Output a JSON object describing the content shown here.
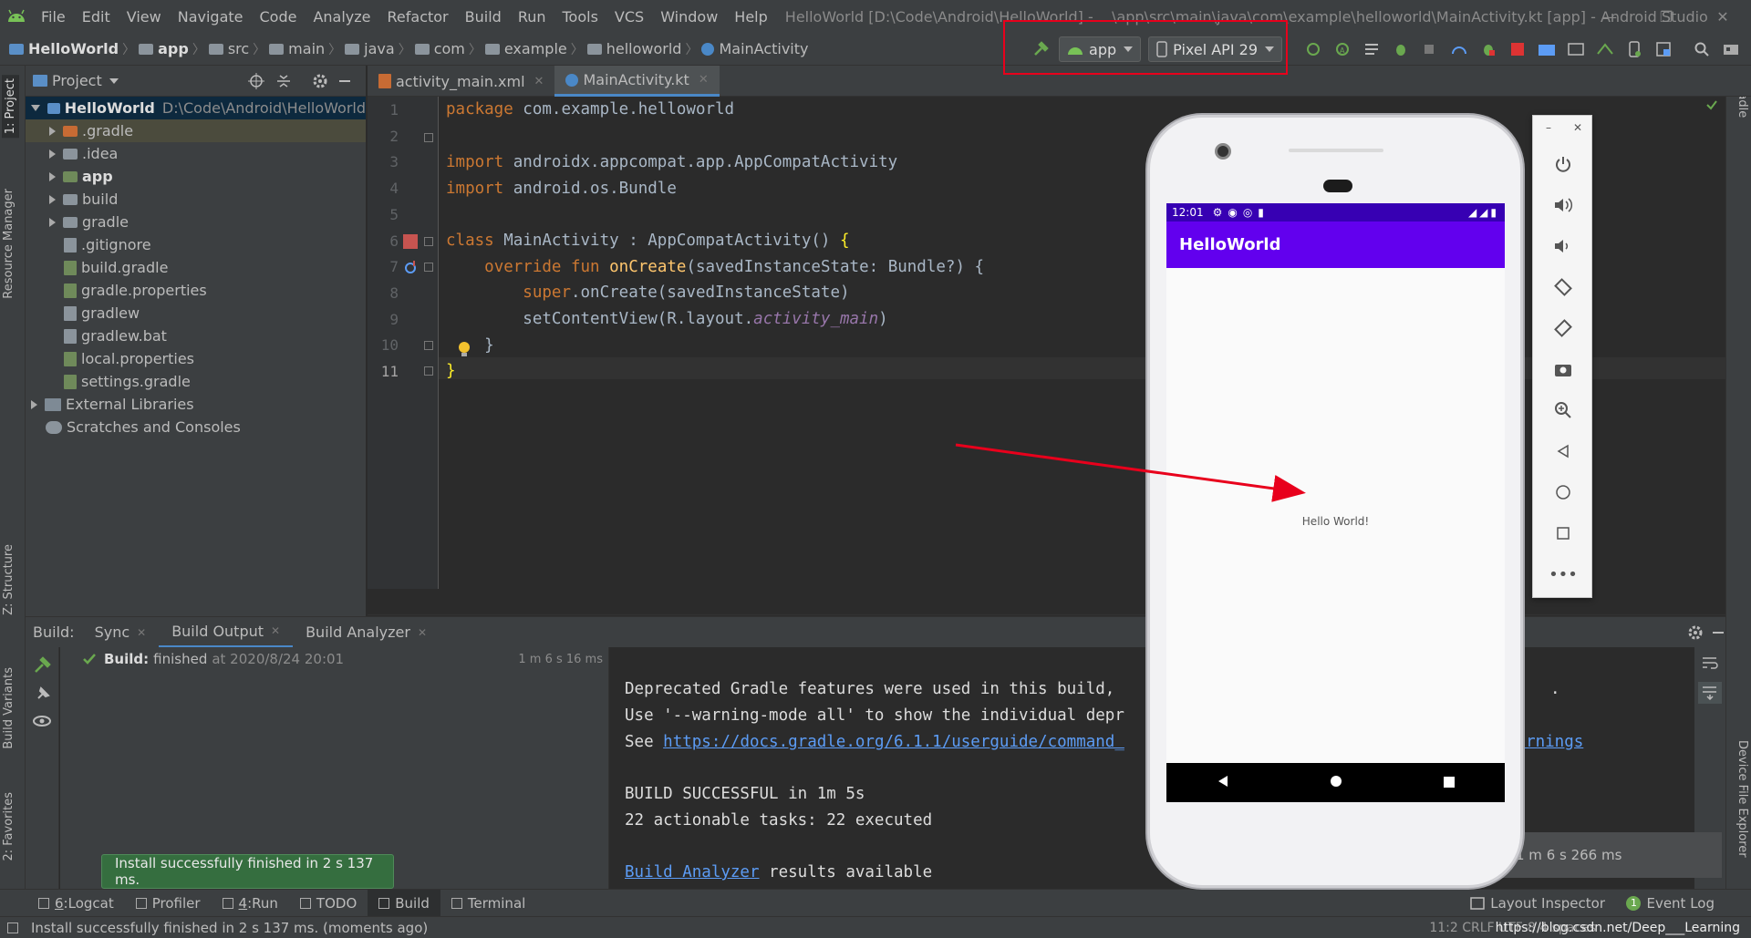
{
  "window": {
    "menus": [
      "File",
      "Edit",
      "View",
      "Navigate",
      "Code",
      "Analyze",
      "Refactor",
      "Build",
      "Run",
      "Tools",
      "VCS",
      "Window",
      "Help"
    ],
    "title": "HelloWorld [D:\\Code\\Android\\HelloWorld] - ...\\app\\src\\main\\java\\com\\example\\helloworld\\MainActivity.kt [app] - Android Studio"
  },
  "breadcrumbs": [
    "HelloWorld",
    "app",
    "src",
    "main",
    "java",
    "com",
    "example",
    "helloworld",
    "MainActivity"
  ],
  "toolbar": {
    "run_config": "app",
    "device": "Pixel API 29"
  },
  "stripes": {
    "left": [
      "1: Project",
      "Resource Manager",
      "Z: Structure",
      "Build Variants",
      "2: Favorites"
    ],
    "right": [
      "Gradle",
      "Device File Explorer"
    ]
  },
  "project": {
    "header": "Project",
    "root": {
      "name": "HelloWorld",
      "path": "D:\\Code\\Android\\HelloWorld"
    },
    "items": [
      {
        "name": ".gradle",
        "kind": "folder-orange",
        "expandable": true
      },
      {
        "name": ".idea",
        "kind": "folder",
        "expandable": true
      },
      {
        "name": "app",
        "kind": "folder-module",
        "expandable": true
      },
      {
        "name": "build",
        "kind": "folder",
        "expandable": true
      },
      {
        "name": "gradle",
        "kind": "folder",
        "expandable": true
      },
      {
        "name": ".gitignore",
        "kind": "file"
      },
      {
        "name": "build.gradle",
        "kind": "gradle"
      },
      {
        "name": "gradle.properties",
        "kind": "gradle"
      },
      {
        "name": "gradlew",
        "kind": "file"
      },
      {
        "name": "gradlew.bat",
        "kind": "file"
      },
      {
        "name": "local.properties",
        "kind": "gradle"
      },
      {
        "name": "settings.gradle",
        "kind": "gradle"
      }
    ],
    "external": "External Libraries",
    "scratches": "Scratches and Consoles"
  },
  "editor": {
    "tabs": [
      {
        "label": "activity_main.xml",
        "active": false
      },
      {
        "label": "MainActivity.kt",
        "active": true
      }
    ],
    "line_numbers": [
      "1",
      "2",
      "3",
      "4",
      "5",
      "6",
      "7",
      "8",
      "9",
      "10",
      "11"
    ]
  },
  "build": {
    "label": "Build:",
    "tabs": [
      {
        "label": "Sync"
      },
      {
        "label": "Build Output",
        "active": true
      },
      {
        "label": "Build Analyzer"
      }
    ],
    "status_bold": "Build:",
    "status_text": "finished",
    "status_time": "at 2020/8/24 20:01",
    "duration": "1 m 6 s 16 ms",
    "console": {
      "l1": "Deprecated Gradle features were used in this build, ",
      "l1end": ".",
      "l2": "Use '--warning-mode all' to show the individual depr",
      "l3pre": "See ",
      "l3link": "https://docs.gradle.org/6.1.1/userguide/command_",
      "l3link2": "warnings",
      "l4": "BUILD SUCCESSFUL in 1m 5s",
      "l5": "22 actionable tasks: 22 executed",
      "l6link": "Build Analyzer",
      "l6": " results available"
    },
    "time_bubble": "1 m 6 s 266 ms"
  },
  "bottom_tabs": [
    {
      "num": "6",
      "label": "Logcat"
    },
    {
      "label": "Profiler"
    },
    {
      "num": "4",
      "label": "Run"
    },
    {
      "label": "TODO"
    },
    {
      "label": "Build",
      "active": true
    },
    {
      "label": "Terminal"
    }
  ],
  "bottom_right": {
    "inspector": "Layout Inspector",
    "event_log": "Event Log",
    "event_count": "1"
  },
  "balloon": "Install successfully finished in 2 s 137 ms.",
  "status": {
    "message": "Install successfully finished in 2 s 137 ms. (moments ago)",
    "right": "11:2  CRLF  UTF-8  4 spaces",
    "watermark": "https://blog.csdn.net/Deep___Learning"
  },
  "emulator": {
    "time": "12:01",
    "app_title": "HelloWorld",
    "hello": "Hello World!"
  },
  "colors": {
    "accent": "#4a88c7",
    "purple": "#6200ee",
    "annotation_red": "#e8001c"
  }
}
